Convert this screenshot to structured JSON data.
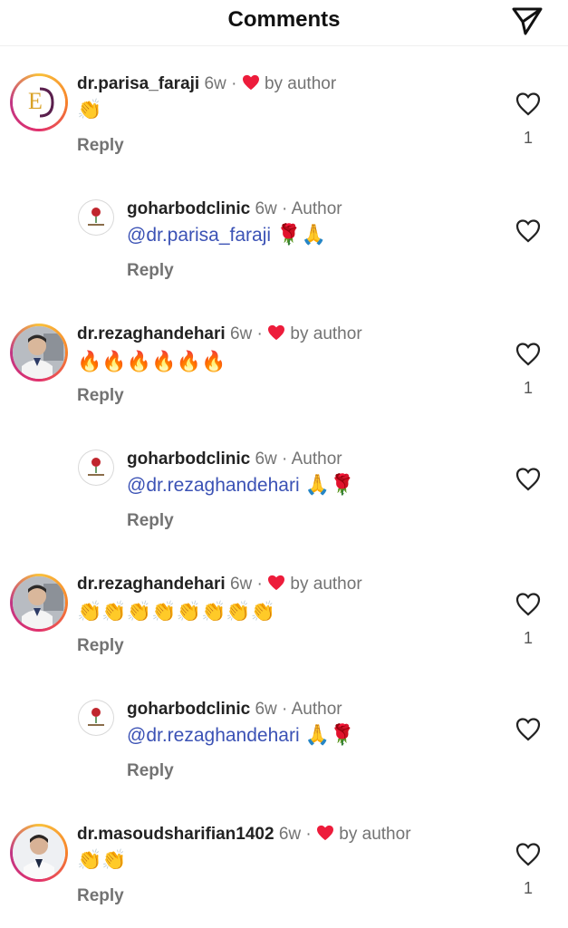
{
  "header": {
    "title": "Comments"
  },
  "comments": [
    {
      "username": "dr.parisa_faraji",
      "time": "6w",
      "dot": "·",
      "liked_by": "by author",
      "emoji": "👏",
      "reply_label": "Reply",
      "likes": "1",
      "icons": [
        "dp-logo-avatar",
        "clap-icon"
      ]
    },
    {
      "username": "goharbodclinic",
      "time": "6w",
      "dot": "·",
      "author_tag": "Author",
      "mention": "@dr.parisa_faraji",
      "emoji": "🌹🙏",
      "reply_label": "Reply",
      "icons": [
        "rose-logo-avatar",
        "rose-icon",
        "pray-icon"
      ]
    },
    {
      "username": "dr.rezaghandehari",
      "time": "6w",
      "dot": "·",
      "liked_by": "by author",
      "emoji": "🔥🔥🔥🔥🔥🔥",
      "reply_label": "Reply",
      "likes": "1",
      "icons": [
        "profile-photo-avatar",
        "fire-icon"
      ]
    },
    {
      "username": "goharbodclinic",
      "time": "6w",
      "dot": "·",
      "author_tag": "Author",
      "mention": "@dr.rezaghandehari",
      "emoji": "🙏🌹",
      "reply_label": "Reply",
      "icons": [
        "rose-logo-avatar",
        "pray-icon",
        "rose-icon"
      ]
    },
    {
      "username": "dr.rezaghandehari",
      "time": "6w",
      "dot": "·",
      "liked_by": "by author",
      "emoji": "👏👏👏👏👏👏👏👏",
      "reply_label": "Reply",
      "likes": "1",
      "icons": [
        "profile-photo-avatar",
        "clap-icon"
      ]
    },
    {
      "username": "goharbodclinic",
      "time": "6w",
      "dot": "·",
      "author_tag": "Author",
      "mention": "@dr.rezaghandehari",
      "emoji": "🙏🌹",
      "reply_label": "Reply",
      "icons": [
        "rose-logo-avatar",
        "pray-icon",
        "rose-icon"
      ]
    },
    {
      "username": "dr.masoudsharifian1402",
      "time": "6w",
      "dot": "·",
      "liked_by": "by author",
      "emoji": "👏👏",
      "reply_label": "Reply",
      "likes": "1",
      "icons": [
        "profile-photo-avatar",
        "clap-icon"
      ]
    }
  ],
  "colors": {
    "mention": "#3b52b5",
    "liked_heart": "#ed1c3b",
    "muted_text": "#737373",
    "ring_gradient": [
      "#f9c23c",
      "#e1306c",
      "#c13584"
    ]
  }
}
